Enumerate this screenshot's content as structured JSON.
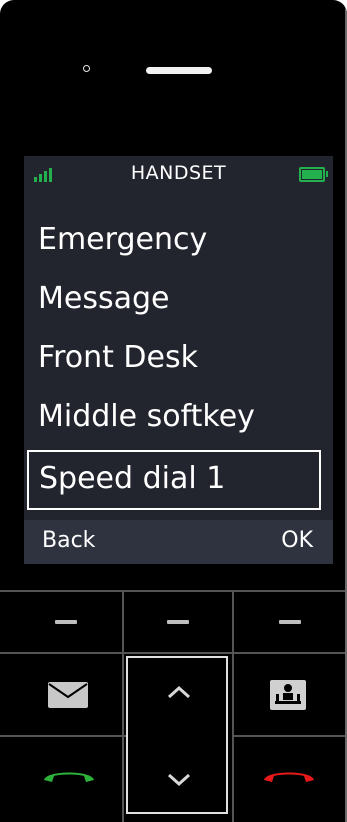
{
  "screen": {
    "title": "HANDSET",
    "menu_items": [
      {
        "label": "Emergency"
      },
      {
        "label": "Message"
      },
      {
        "label": "Front Desk"
      },
      {
        "label": "Middle softkey"
      },
      {
        "label": "Speed dial 1",
        "selected": true
      }
    ],
    "softkeys": {
      "left": "Back",
      "right": "OK"
    }
  },
  "icons": {
    "signal": "signal-strength-icon",
    "battery": "battery-icon",
    "message": "envelope-icon",
    "directory": "contacts-icon",
    "up": "chevron-up-icon",
    "down": "chevron-down-icon",
    "call": "green-phone-icon",
    "end": "red-phone-icon"
  },
  "colors": {
    "screen_bg": "#22252e",
    "status_green": "#22b14c",
    "call_green": "#2cb23a",
    "end_red": "#e8191b"
  }
}
